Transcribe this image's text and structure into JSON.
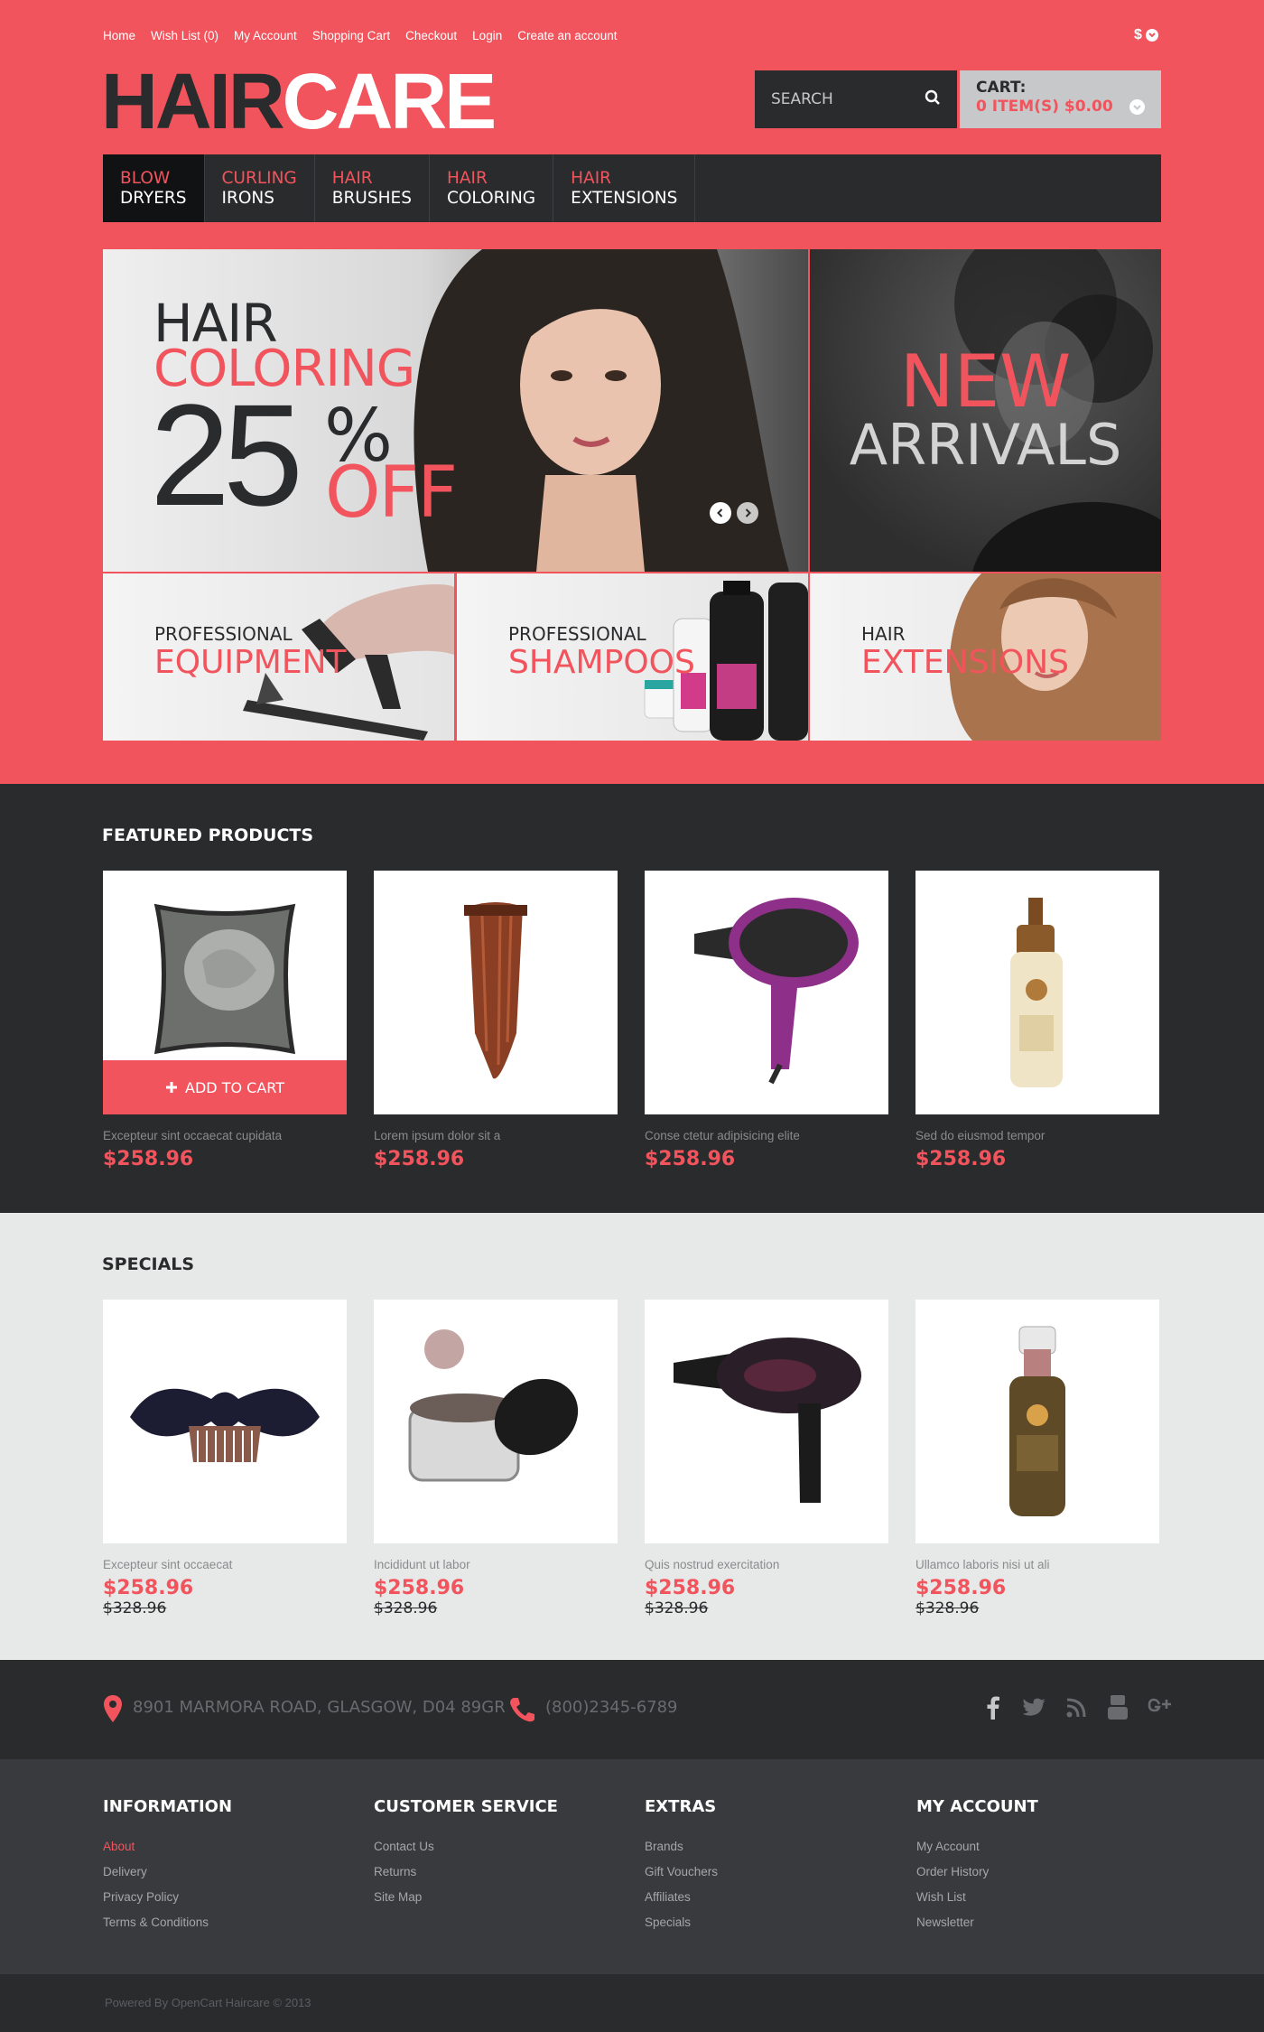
{
  "top_links": [
    "Home",
    "Wish List (0)",
    "My Account",
    "Shopping Cart",
    "Checkout",
    "Login",
    "Create an account"
  ],
  "currency": "$",
  "logo": {
    "part1": "HAIR",
    "part2": "CARE"
  },
  "search": {
    "placeholder": "SEARCH"
  },
  "cart": {
    "label": "CART:",
    "summary": "0 ITEM(S) $0.00"
  },
  "nav": [
    {
      "top": "BLOW",
      "bottom": "DRYERS"
    },
    {
      "top": "CURLING",
      "bottom": "IRONS"
    },
    {
      "top": "HAIR",
      "bottom": "BRUSHES"
    },
    {
      "top": "HAIR",
      "bottom": "COLORING"
    },
    {
      "top": "HAIR",
      "bottom": "EXTENSIONS"
    }
  ],
  "banner_main": {
    "line1": "HAIR",
    "line2": "COLORING",
    "number": "25",
    "percent": "%",
    "off": "OFF"
  },
  "banner_new": {
    "line1": "NEW",
    "line2": "ARRIVALS"
  },
  "banners_small": [
    {
      "line1": "PROFESSIONAL",
      "line2": "EQUIPMENT"
    },
    {
      "line1": "PROFESSIONAL",
      "line2": "SHAMPOOS"
    },
    {
      "line1": "HAIR",
      "line2": "EXTENSIONS"
    }
  ],
  "featured": {
    "title": "FEATURED PRODUCTS",
    "add_to_cart": "ADD TO CART",
    "products": [
      {
        "name": "Excepteur sint occaecat cupidata",
        "price": "$258.96"
      },
      {
        "name": "Lorem ipsum dolor sit a",
        "price": "$258.96"
      },
      {
        "name": "Conse ctetur adipisicing elite",
        "price": "$258.96"
      },
      {
        "name": "Sed do eiusmod tempor",
        "price": "$258.96"
      }
    ]
  },
  "specials": {
    "title": "SPECIALS",
    "products": [
      {
        "name": "Excepteur sint occaecat",
        "price": "$258.96",
        "old": "$328.96"
      },
      {
        "name": "Incididunt ut labor",
        "price": "$258.96",
        "old": "$328.96"
      },
      {
        "name": "Quis nostrud exercitation",
        "price": "$258.96",
        "old": "$328.96"
      },
      {
        "name": "Ullamco laboris nisi ut ali",
        "price": "$258.96",
        "old": "$328.96"
      }
    ]
  },
  "contact": {
    "address": "8901 MARMORA ROAD, GLASGOW, D04 89GR",
    "phone": "(800)2345-6789"
  },
  "footer": {
    "columns": [
      {
        "title": "INFORMATION",
        "links": [
          "About",
          "Delivery",
          "Privacy Policy",
          "Terms & Conditions"
        ]
      },
      {
        "title": "CUSTOMER SERVICE",
        "links": [
          "Contact Us",
          "Returns",
          "Site Map"
        ]
      },
      {
        "title": "EXTRAS",
        "links": [
          "Brands",
          "Gift Vouchers",
          "Affiliates",
          "Specials"
        ]
      },
      {
        "title": "MY ACCOUNT",
        "links": [
          "My Account",
          "Order History",
          "Wish List",
          "Newsletter"
        ]
      }
    ],
    "copyright": "Powered By OpenCart Haircare © 2013"
  },
  "colors": {
    "accent": "#f1545c",
    "dark": "#2a2b2d",
    "footer": "#393a3d",
    "light": "#e7e8e8"
  }
}
